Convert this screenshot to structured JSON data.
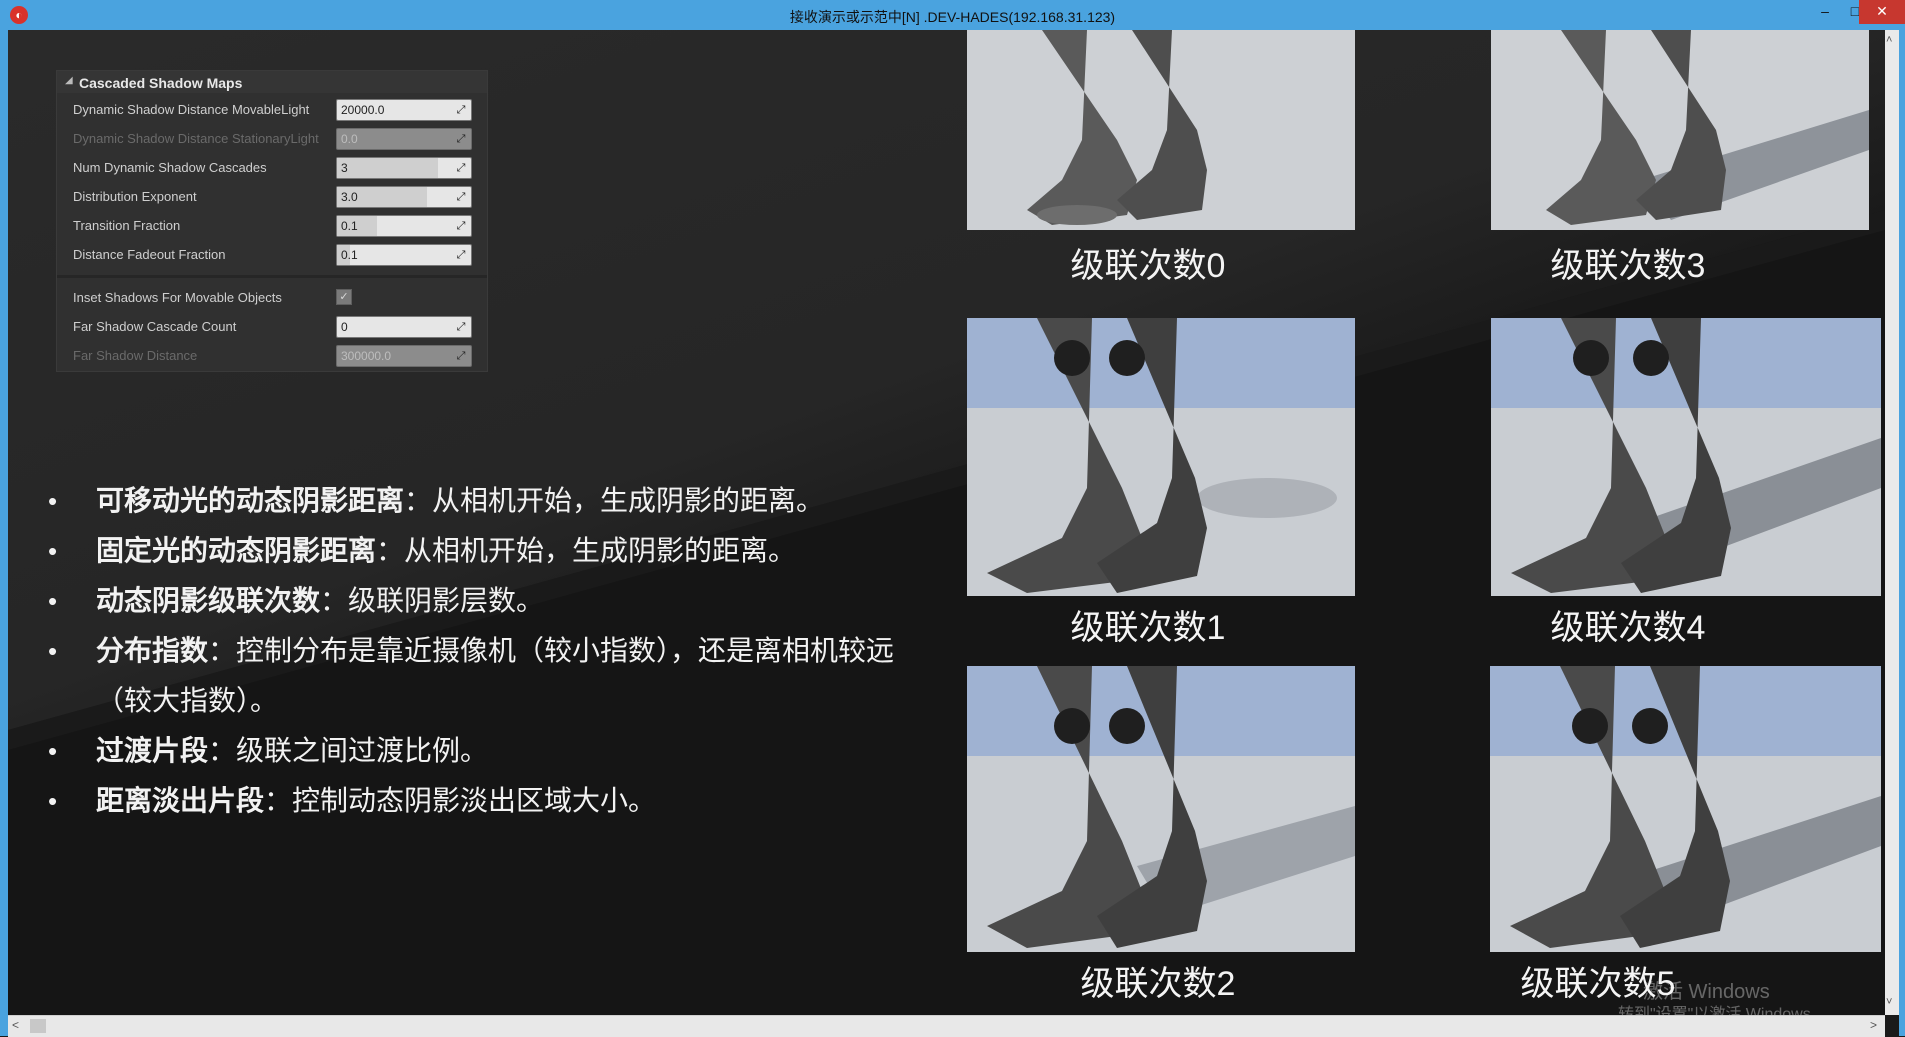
{
  "window": {
    "title": "接收演示或示范中[N] .DEV-HADES(192.168.31.123)",
    "minimize": "–",
    "maximize": "□",
    "close": "✕"
  },
  "panel": {
    "header": "Cascaded Shadow Maps",
    "rows": [
      {
        "label": "Dynamic Shadow Distance MovableLight",
        "value": "20000.0",
        "disabled": false,
        "fill": 0
      },
      {
        "label": "Dynamic Shadow Distance StationaryLight",
        "value": "0.0",
        "disabled": true,
        "fill": 0
      },
      {
        "label": "Num Dynamic Shadow Cascades",
        "value": "3",
        "disabled": false,
        "fill": 0.75
      },
      {
        "label": "Distribution Exponent",
        "value": "3.0",
        "disabled": false,
        "fill": 0.67
      },
      {
        "label": "Transition Fraction",
        "value": "0.1",
        "disabled": false,
        "fill": 0.3
      },
      {
        "label": "Distance Fadeout Fraction",
        "value": "0.1",
        "disabled": false,
        "fill": 0.1
      }
    ],
    "rows2": [
      {
        "label": "Inset Shadows For Movable Objects",
        "checked": true
      },
      {
        "label": "Far Shadow Cascade Count",
        "value": "0",
        "disabled": false
      },
      {
        "label": "Far Shadow Distance",
        "value": "300000.0",
        "disabled": true
      }
    ]
  },
  "bullets": [
    {
      "bold": "可移动光的动态阴影距离",
      "text": "：从相机开始，生成阴影的距离。"
    },
    {
      "bold": "固定光的动态阴影距离",
      "text": "：从相机开始，生成阴影的距离。"
    },
    {
      "bold": "动态阴影级联次数",
      "text": "：级联阴影层数。"
    },
    {
      "bold": "分布指数",
      "text": "：控制分布是靠近摄像机（较小指数），还是离相机较远",
      "cont": "（较大指数）。"
    },
    {
      "bold": "过渡片段",
      "text": "：级联之间过渡比例。"
    },
    {
      "bold": "距离淡出片段",
      "text": "：控制动态阴影淡出区域大小。"
    }
  ],
  "captions": {
    "c0": "级联次数0",
    "c1": "级联次数1",
    "c2": "级联次数2",
    "c3": "级联次数3",
    "c4": "级联次数4",
    "c5": "级联次数5"
  },
  "watermark": {
    "line1": "激活 Windows",
    "line2": "转到\"设置\"以激活 Windows。"
  },
  "scroll": {
    "left": "<",
    "right": ">",
    "up": "˄",
    "down": "˅"
  },
  "icons": {
    "app": "app-logo-icon",
    "reset": "reset-arrow-icon",
    "check": "checkmark-icon",
    "expand": "collapse-triangle-icon"
  }
}
